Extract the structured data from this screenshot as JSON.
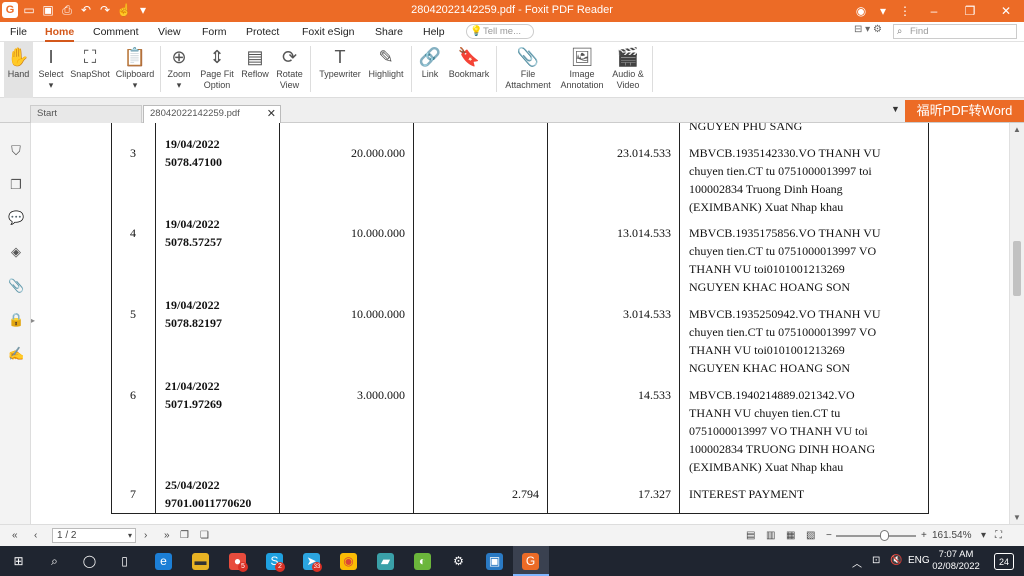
{
  "window": {
    "title": "28042022142259.pdf - Foxit PDF Reader",
    "accent": "#ec6b26"
  },
  "menu": {
    "items": [
      "File",
      "Home",
      "Comment",
      "View",
      "Form",
      "Protect",
      "Foxit eSign",
      "Share",
      "Help"
    ],
    "active": "Home",
    "tell_me_placeholder": "Tell me...",
    "find_placeholder": "Find"
  },
  "ribbon": {
    "tools": [
      {
        "label": "Hand",
        "icon": "hand-icon"
      },
      {
        "label": "Select",
        "icon": "select-icon"
      },
      {
        "label": "SnapShot",
        "icon": "snapshot-icon"
      },
      {
        "label": "Clipboard",
        "icon": "clipboard-icon"
      },
      {
        "label": "Zoom",
        "icon": "zoom-icon"
      },
      {
        "label": "Page Fit Option",
        "icon": "page-fit-icon"
      },
      {
        "label": "Reflow",
        "icon": "reflow-icon"
      },
      {
        "label": "Rotate View",
        "icon": "rotate-icon"
      },
      {
        "label": "Typewriter",
        "icon": "typewriter-icon"
      },
      {
        "label": "Highlight",
        "icon": "highlight-icon"
      },
      {
        "label": "Link",
        "icon": "link-icon"
      },
      {
        "label": "Bookmark",
        "icon": "bookmark-icon"
      },
      {
        "label": "File Attachment",
        "icon": "file-attachment-icon"
      },
      {
        "label": "Image Annotation",
        "icon": "image-annotation-icon"
      },
      {
        "label": "Audio & Video",
        "icon": "audio-video-icon"
      }
    ]
  },
  "tabs": {
    "start": "Start",
    "document": "28042022142259.pdf"
  },
  "promo": {
    "label": "福昕PDF转Word"
  },
  "document": {
    "top_fragment": "NGUYEN PHU SANG",
    "rows": [
      {
        "no": "3",
        "date": "19/04/2022",
        "ref": "5078.47100",
        "credit": "20.000.000",
        "debit": "",
        "balance": "23.014.533",
        "desc": [
          "MBVCB.1935142330.VO THANH VU",
          "chuyen tien.CT tu 0751000013997 toi",
          "100002834 Truong Dinh Hoang",
          "(EXIMBANK) Xuat Nhap khau"
        ]
      },
      {
        "no": "4",
        "date": "19/04/2022",
        "ref": "5078.57257",
        "credit": "10.000.000",
        "debit": "",
        "balance": "13.014.533",
        "desc": [
          "MBVCB.1935175856.VO THANH VU",
          "chuyen tien.CT tu 0751000013997 VO",
          "THANH VU toi0101001213269",
          "NGUYEN KHAC HOANG SON"
        ]
      },
      {
        "no": "5",
        "date": "19/04/2022",
        "ref": "5078.82197",
        "credit": "10.000.000",
        "debit": "",
        "balance": "3.014.533",
        "desc": [
          "MBVCB.1935250942.VO THANH VU",
          "chuyen tien.CT tu 0751000013997 VO",
          "THANH VU toi0101001213269",
          "NGUYEN KHAC HOANG SON"
        ]
      },
      {
        "no": "6",
        "date": "21/04/2022",
        "ref": "5071.97269",
        "credit": "3.000.000",
        "debit": "",
        "balance": "14.533",
        "desc": [
          "MBVCB.1940214889.021342.VO",
          "THANH VU chuyen tien.CT tu",
          "0751000013997 VO THANH VU toi",
          "100002834 TRUONG DINH HOANG",
          "(EXIMBANK) Xuat Nhap khau"
        ]
      },
      {
        "no": "7",
        "date": "25/04/2022",
        "ref": "9701.0011770620",
        "credit": "",
        "debit": "2.794",
        "balance": "17.327",
        "desc": [
          "INTEREST PAYMENT"
        ]
      }
    ]
  },
  "statusbar": {
    "page_value": "1 / 2",
    "zoom": "161.54%",
    "zoom_minus": "−",
    "zoom_plus": "+"
  },
  "taskbar": {
    "language": "ENG",
    "time": "7:07 AM",
    "date": "02/08/2022",
    "notif_count": "24",
    "badges": {
      "app1": "5",
      "skype": "2",
      "telegram": "33"
    }
  }
}
